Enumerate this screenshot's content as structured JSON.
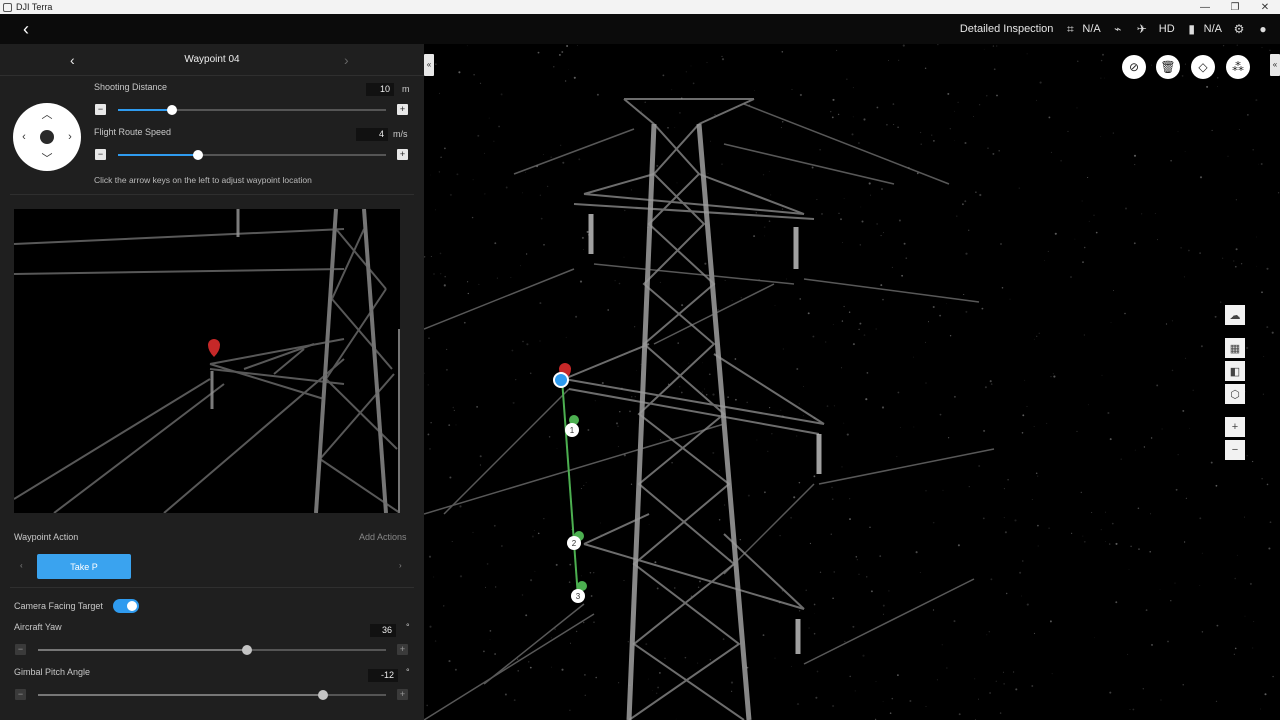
{
  "window": {
    "title": "DJI Terra",
    "min": "—",
    "restore": "❐",
    "close": "✕"
  },
  "topbar": {
    "back": "‹",
    "mode": "Detailed Inspection",
    "signal_value": "N/A",
    "video_quality": "HD",
    "battery_value": "N/A"
  },
  "waypoint": {
    "title": "Waypoint 04",
    "prev": "‹",
    "next": "›"
  },
  "shooting_distance": {
    "label": "Shooting Distance",
    "value": "10",
    "unit": "m",
    "level": 0.2
  },
  "flight_speed": {
    "label": "Flight Route Speed",
    "value": "4",
    "unit": "m/s",
    "level": 0.3
  },
  "hint": "Click the arrow keys on the left to adjust waypoint location",
  "waypoint_action": {
    "label": "Waypoint Action",
    "add_label": "Add Actions",
    "action": "Take P"
  },
  "camera_facing": {
    "label": "Camera Facing Target",
    "enabled": true
  },
  "aircraft_yaw": {
    "label": "Aircraft Yaw",
    "value": "36",
    "unit": "°",
    "level": 0.6
  },
  "gimbal_pitch": {
    "label": "Gimbal Pitch Angle",
    "value": "-12",
    "unit": "°",
    "level": 0.82
  },
  "icons": {
    "minus": "−",
    "plus": "+",
    "arrow_left": "‹",
    "arrow_right": "›",
    "collapse_left": "«",
    "collapse_right": "«",
    "zoom_in": "+",
    "zoom_out": "−"
  },
  "waypoint_markers": [
    "1",
    "2",
    "3"
  ],
  "colors": {
    "accent": "#2f9bef",
    "route": "#4caf50",
    "marker_red": "#c62828"
  }
}
